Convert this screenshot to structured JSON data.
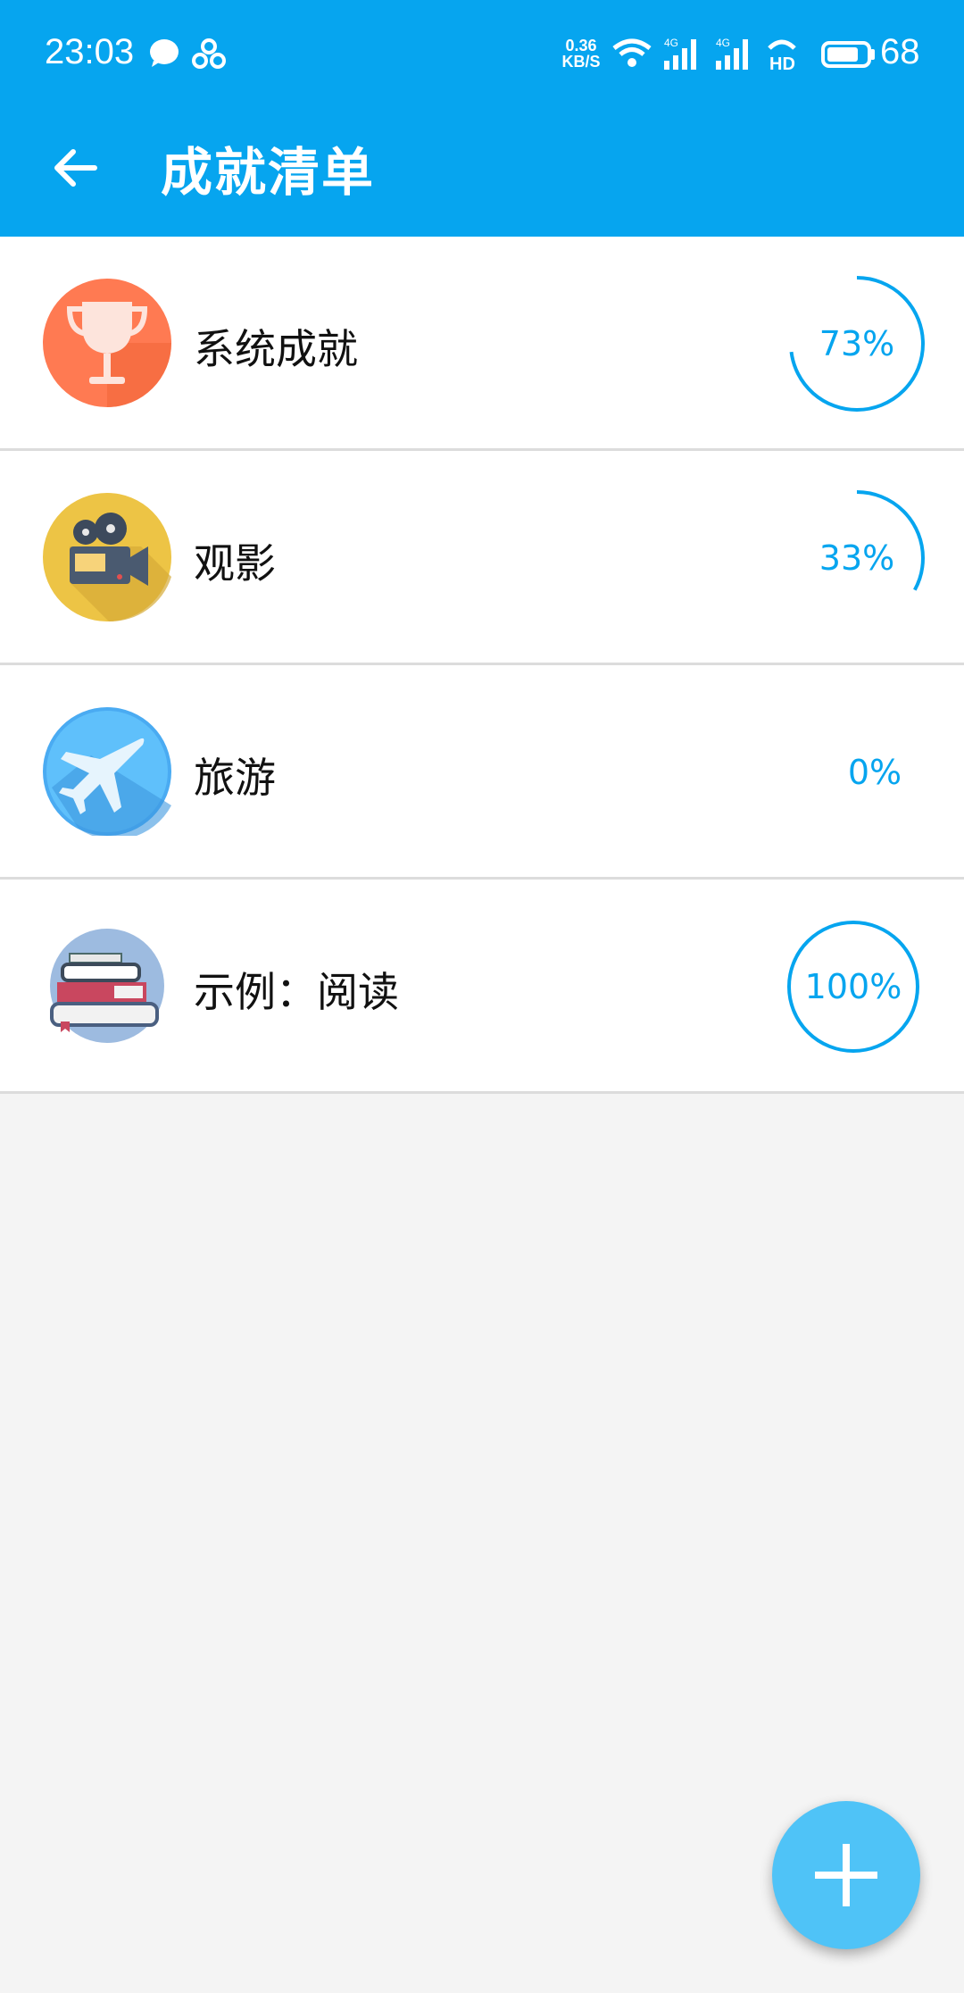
{
  "status_bar": {
    "time": "23:03",
    "net_speed_value": "0.36",
    "net_speed_unit": "KB/S",
    "battery_level": "68"
  },
  "toolbar": {
    "title": "成就清单"
  },
  "achievements": [
    {
      "label": "系统成就",
      "progress_text": "73%",
      "progress": 0.73,
      "icon": "trophy-icon",
      "color": "#ff7a52"
    },
    {
      "label": "观影",
      "progress_text": "33%",
      "progress": 0.33,
      "icon": "movie-camera-icon",
      "color": "#edc445"
    },
    {
      "label": "旅游",
      "progress_text": "0%",
      "progress": 0.0,
      "icon": "airplane-icon",
      "color": "#4aabf2"
    },
    {
      "label": "示例：阅读",
      "progress_text": "100%",
      "progress": 1.0,
      "icon": "books-icon",
      "color": "#9dbbe0"
    }
  ],
  "colors": {
    "primary": "#06a5ef",
    "progress": "#06a5ef",
    "fab": "#4fc3f7"
  }
}
